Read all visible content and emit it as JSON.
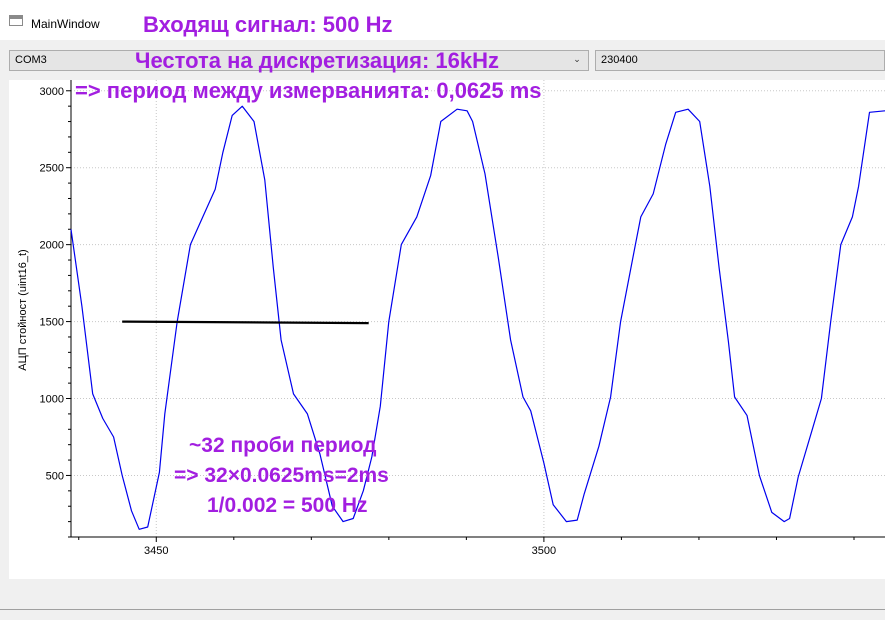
{
  "window": {
    "title": "MainWindow"
  },
  "toolbar": {
    "port_value": "COM3",
    "baud_value": "230400"
  },
  "annotations": {
    "line1": "Входящ сигнал: 500 Hz",
    "line2": "Честота на дискретизация: 16kHz",
    "line3": "=> период между измерванията: 0,0625 ms",
    "note1": "~32 проби период",
    "note2": "=> 32×0.0625ms=2ms",
    "note3": "1/0.002 = 500 Hz",
    "color": "#a21ee0"
  },
  "chart_data": {
    "type": "line",
    "title": "",
    "xlabel": "",
    "ylabel": "АЦП стойност (uint16_t)",
    "xlim": [
      3439,
      3544
    ],
    "ylim": [
      100,
      3070
    ],
    "x_ticks": [
      3450,
      3500
    ],
    "y_ticks": [
      500,
      1000,
      1500,
      2000,
      2500,
      3000
    ],
    "grid": true,
    "line_color": "#0000ee",
    "series": [
      {
        "name": "",
        "x": [
          3439,
          3440.4,
          3441.8,
          3443.1,
          3444.5,
          3445.6,
          3446.8,
          3447.8,
          3448.9,
          3450.4,
          3451.1,
          3452.7,
          3454.4,
          3456,
          3457.6,
          3458.6,
          3459.8,
          3461.1,
          3462.6,
          3464,
          3465.1,
          3466.1,
          3467.7,
          3469.5,
          3471.1,
          3472.7,
          3474.1,
          3475.4,
          3476.7,
          3477.8,
          3478.9,
          3480,
          3481.6,
          3483.6,
          3485.4,
          3486.7,
          3488.8,
          3490.1,
          3490.8,
          3492.4,
          3494.1,
          3495.7,
          3497.3,
          3498.3,
          3500,
          3501.2,
          3502.9,
          3504.3,
          3505.2,
          3507.1,
          3508.6,
          3509.9,
          3511.8,
          3512.5,
          3514.1,
          3515.7,
          3517,
          3518.6,
          3520.1,
          3521.4,
          3522.6,
          3523.8,
          3524.6,
          3526.2,
          3527.8,
          3529.4,
          3531,
          3531.7,
          3532.8,
          3534.5,
          3535.8,
          3537,
          3538.3,
          3539.8,
          3540.6,
          3542,
          3544
        ],
        "y": [
          2100,
          1600,
          1030,
          870,
          750,
          500,
          270,
          150,
          165,
          520,
          900,
          1500,
          2000,
          2180,
          2360,
          2600,
          2840,
          2900,
          2800,
          2420,
          1850,
          1380,
          1030,
          900,
          640,
          300,
          200,
          220,
          400,
          620,
          950,
          1500,
          2000,
          2180,
          2450,
          2800,
          2880,
          2870,
          2800,
          2460,
          1920,
          1380,
          1010,
          920,
          580,
          310,
          200,
          210,
          380,
          690,
          1010,
          1500,
          2000,
          2180,
          2330,
          2650,
          2860,
          2880,
          2800,
          2380,
          1850,
          1370,
          1010,
          890,
          500,
          260,
          200,
          220,
          490,
          780,
          1000,
          1500,
          2000,
          2180,
          2380,
          2860,
          2870
        ]
      },
      {
        "name": "",
        "x": [
          3445.6,
          3477.4
        ],
        "y": [
          1500,
          1490
        ],
        "color": "#000000"
      }
    ]
  }
}
